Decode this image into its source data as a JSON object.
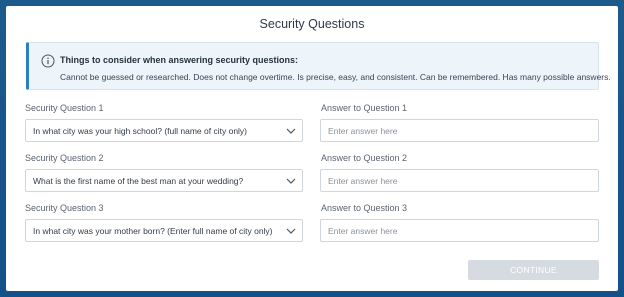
{
  "dialog": {
    "title": "Security Questions"
  },
  "info": {
    "icon": "info-circle-icon",
    "heading": "Things to consider when answering security questions:",
    "body": "Cannot be guessed or researched. Does not change overtime. Is precise, easy, and consistent. Can be remembered. Has many possible answers."
  },
  "questions": [
    {
      "label": "Security Question 1",
      "selected": "In what city was your high school? (full name of city only)",
      "answer_label": "Answer to Question 1",
      "answer_placeholder": "Enter answer here",
      "answer_value": ""
    },
    {
      "label": "Security Question 2",
      "selected": "What is the first name of the best man at your wedding?",
      "answer_label": "Answer to Question 2",
      "answer_placeholder": "Enter answer here",
      "answer_value": ""
    },
    {
      "label": "Security Question 3",
      "selected": "In what city was your mother born? (Enter full name of city only)",
      "answer_label": "Answer to Question 3",
      "answer_placeholder": "Enter answer here",
      "answer_value": ""
    }
  ],
  "actions": {
    "continue_label": "CONTINUE",
    "continue_enabled": false
  },
  "colors": {
    "background": "#14508a",
    "info_accent": "#2b7fbf",
    "button_disabled": "#d5dbe1"
  }
}
